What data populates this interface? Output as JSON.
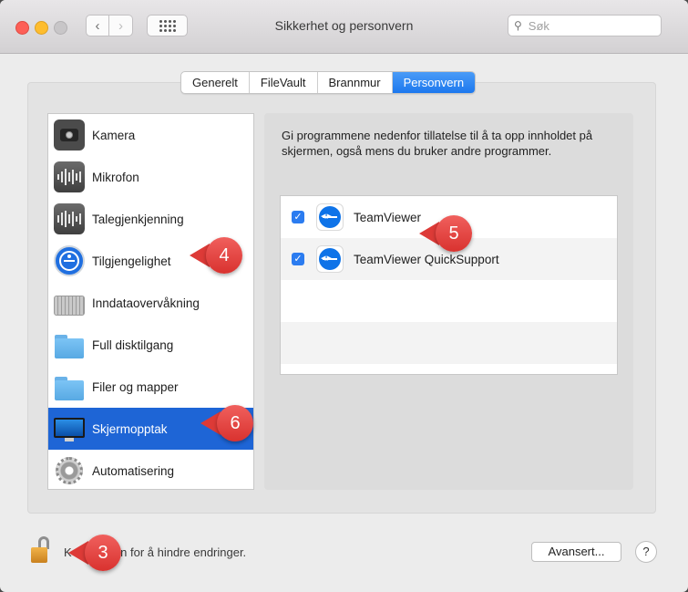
{
  "window": {
    "title": "Sikkerhet og personvern"
  },
  "search": {
    "placeholder": "Søk",
    "icon": "search-icon"
  },
  "nav": {
    "back_icon": "chevron-left-icon",
    "forward_icon": "chevron-right-icon",
    "grid_icon": "grid-icon"
  },
  "tabs": [
    {
      "label": "Generelt",
      "active": false
    },
    {
      "label": "FileVault",
      "active": false
    },
    {
      "label": "Brannmur",
      "active": false
    },
    {
      "label": "Personvern",
      "active": true
    }
  ],
  "categories": [
    {
      "label": "Kamera",
      "icon": "camera-icon"
    },
    {
      "label": "Mikrofon",
      "icon": "microphone-icon"
    },
    {
      "label": "Talegjenkjenning",
      "icon": "speech-recognition-icon"
    },
    {
      "label": "Tilgjengelighet",
      "icon": "accessibility-icon"
    },
    {
      "label": "Inndataovervåkning",
      "icon": "keyboard-icon"
    },
    {
      "label": "Full disktilgang",
      "icon": "folder-icon"
    },
    {
      "label": "Filer og mapper",
      "icon": "folder-icon"
    },
    {
      "label": "Skjermopptak",
      "icon": "display-icon",
      "selected": true
    },
    {
      "label": "Automatisering",
      "icon": "gear-icon"
    }
  ],
  "main": {
    "description": "Gi programmene nedenfor tillatelse til å ta opp innholdet på skjermen, også mens du bruker andre programmer.",
    "apps": [
      {
        "name": "TeamViewer",
        "checked": true,
        "icon": "teamviewer-icon"
      },
      {
        "name": "TeamViewer QuickSupport",
        "checked": true,
        "icon": "teamviewer-icon"
      }
    ]
  },
  "footer": {
    "lock_text": "Klikk på hengelåsen for å hindre endringer.",
    "visible_lock_text": "K         asen for å hindre endringer.",
    "advanced_label": "Avansert...",
    "help_label": "?"
  },
  "callouts": {
    "c3": "3",
    "c4": "4",
    "c5": "5",
    "c6": "6"
  },
  "colors": {
    "selection": "#1e65d6",
    "tab_active": "#1c78ee",
    "callout": "#dd3a37",
    "checkbox": "#2b7cf0"
  }
}
